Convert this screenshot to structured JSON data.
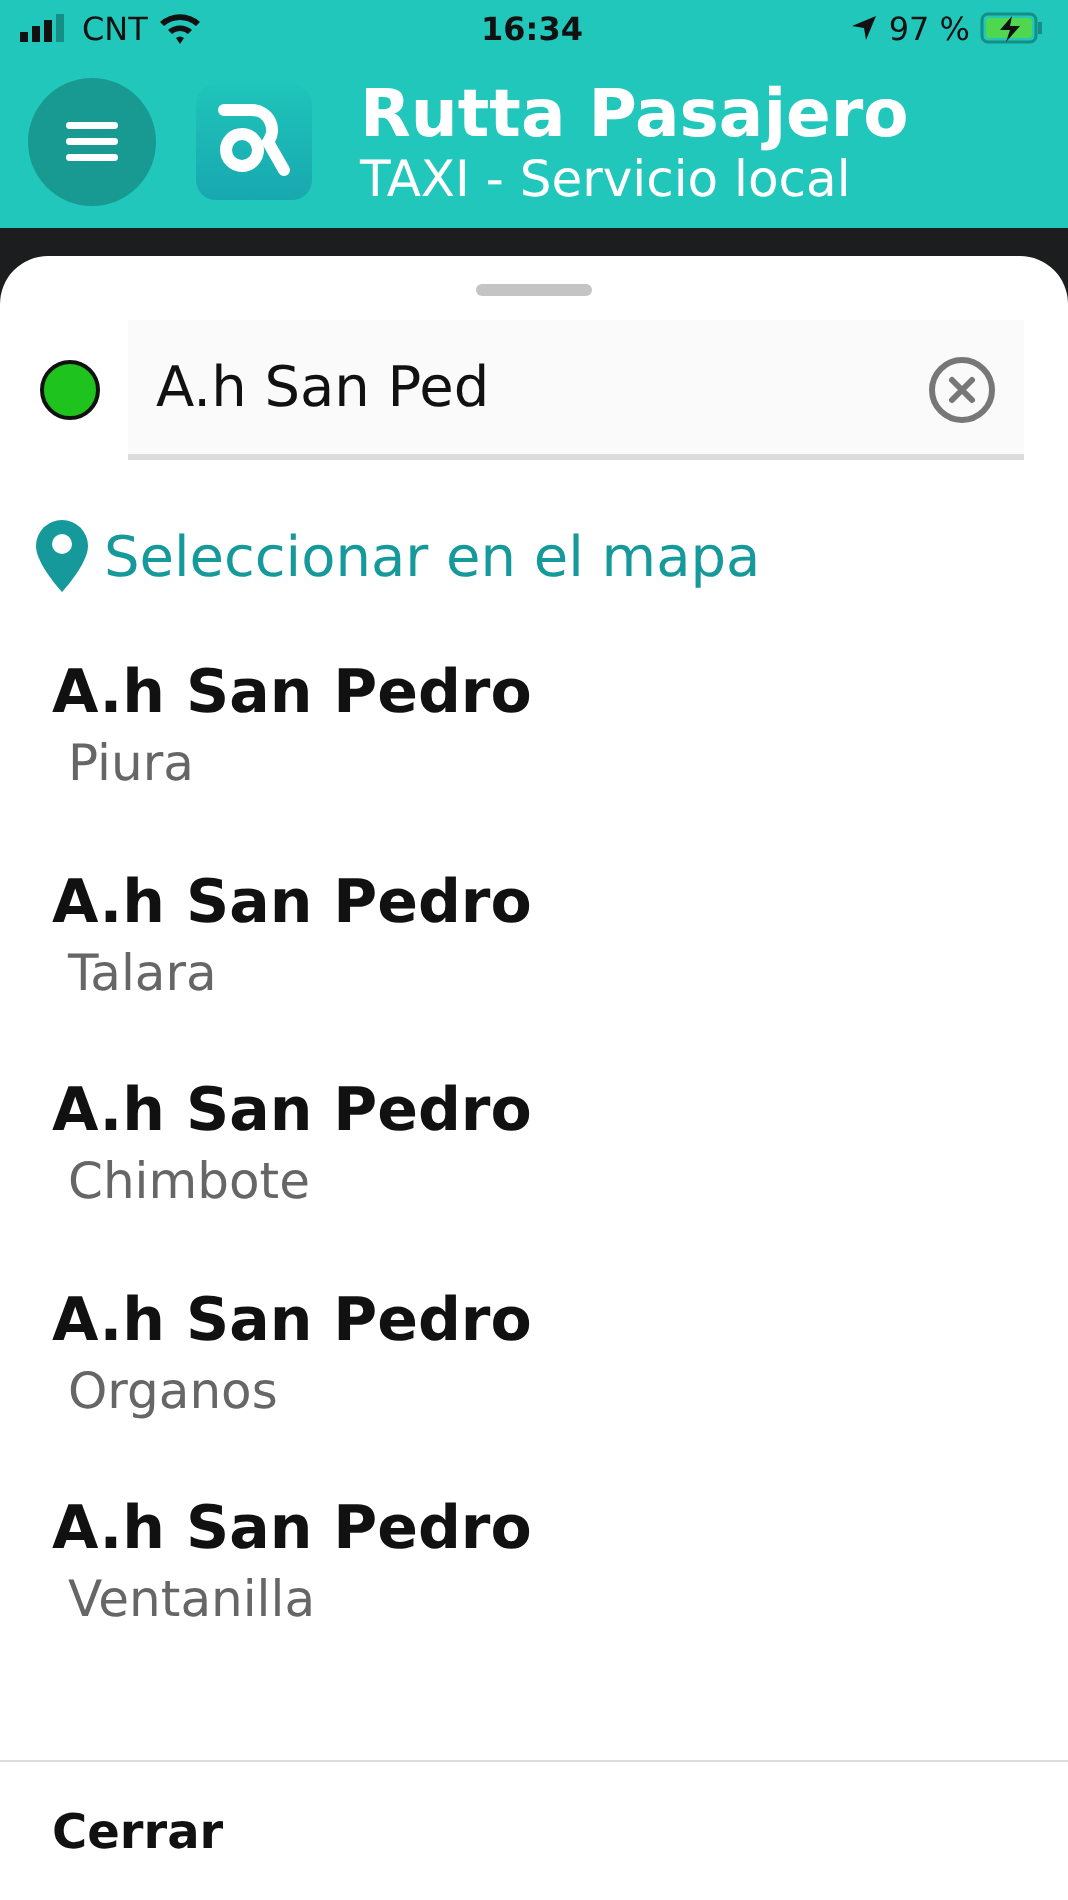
{
  "status_bar": {
    "carrier": "CNT",
    "time": "16:34",
    "battery": "97 %"
  },
  "header": {
    "title": "Rutta Pasajero",
    "subtitle": "TAXI - Servicio local"
  },
  "search": {
    "value": "A.h San Ped"
  },
  "map_link": "Seleccionar en el mapa",
  "results": [
    {
      "name": "A.h San Pedro",
      "city": "Piura"
    },
    {
      "name": "A.h San Pedro",
      "city": "Talara"
    },
    {
      "name": "A.h San Pedro",
      "city": "Chimbote"
    },
    {
      "name": "A.h San Pedro",
      "city": "Organos"
    },
    {
      "name": "A.h San Pedro",
      "city": "Ventanilla"
    }
  ],
  "footer_button": "Cerrar"
}
